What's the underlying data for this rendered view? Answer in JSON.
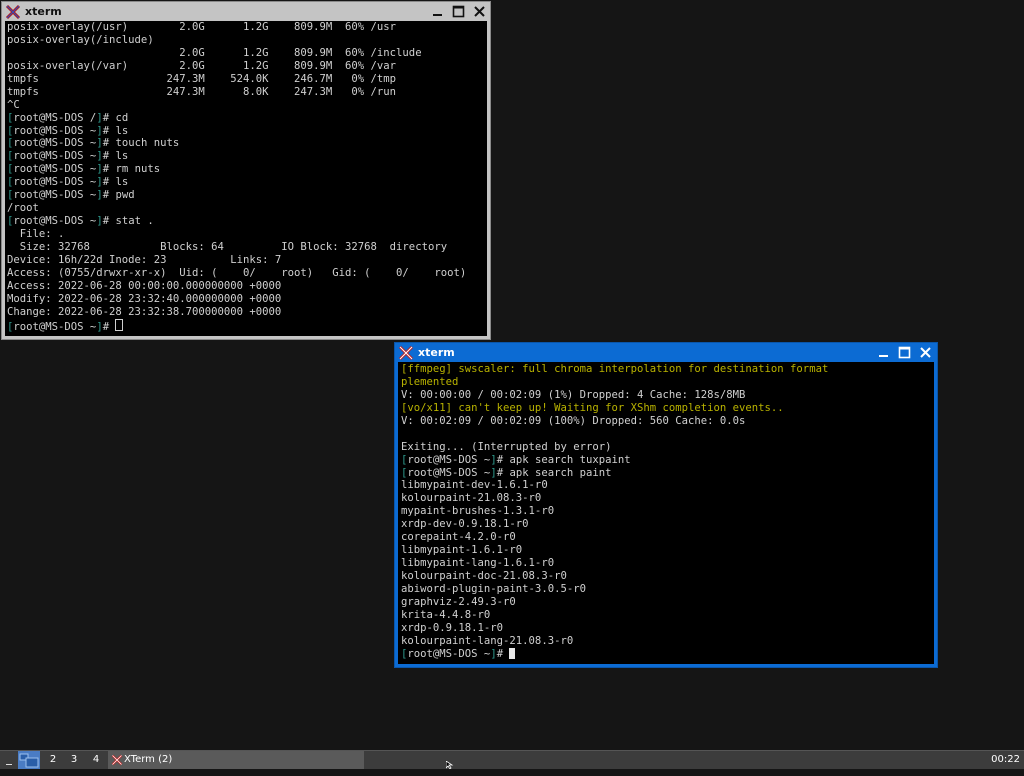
{
  "windows": {
    "left": {
      "title": "xterm",
      "lines": [
        [
          {
            "t": "posix-overlay(/usr)        2.0G      1.2G    809.9M  60% /usr"
          }
        ],
        [
          {
            "t": "posix-overlay(/include)"
          }
        ],
        [
          {
            "t": "                           2.0G      1.2G    809.9M  60% /include"
          }
        ],
        [
          {
            "t": "posix-overlay(/var)        2.0G      1.2G    809.9M  60% /var"
          }
        ],
        [
          {
            "t": "tmpfs                    247.3M    524.0K    246.7M   0% /tmp"
          }
        ],
        [
          {
            "t": "tmpfs                    247.3M      8.0K    247.3M   0% /run"
          }
        ],
        [
          {
            "t": "^C"
          }
        ],
        [
          {
            "c": "bracket",
            "t": "["
          },
          {
            "t": "root@MS-DOS /"
          },
          {
            "c": "bracket",
            "t": "]"
          },
          {
            "t": "# cd"
          }
        ],
        [
          {
            "c": "bracket",
            "t": "["
          },
          {
            "t": "root@MS-DOS ~"
          },
          {
            "c": "bracket",
            "t": "]"
          },
          {
            "t": "# ls"
          }
        ],
        [
          {
            "c": "bracket",
            "t": "["
          },
          {
            "t": "root@MS-DOS ~"
          },
          {
            "c": "bracket",
            "t": "]"
          },
          {
            "t": "# touch nuts"
          }
        ],
        [
          {
            "c": "bracket",
            "t": "["
          },
          {
            "t": "root@MS-DOS ~"
          },
          {
            "c": "bracket",
            "t": "]"
          },
          {
            "t": "# ls"
          }
        ],
        [
          {
            "c": "bracket",
            "t": "["
          },
          {
            "t": "root@MS-DOS ~"
          },
          {
            "c": "bracket",
            "t": "]"
          },
          {
            "t": "# rm nuts"
          }
        ],
        [
          {
            "c": "bracket",
            "t": "["
          },
          {
            "t": "root@MS-DOS ~"
          },
          {
            "c": "bracket",
            "t": "]"
          },
          {
            "t": "# ls"
          }
        ],
        [
          {
            "c": "bracket",
            "t": "["
          },
          {
            "t": "root@MS-DOS ~"
          },
          {
            "c": "bracket",
            "t": "]"
          },
          {
            "t": "# pwd"
          }
        ],
        [
          {
            "t": "/root"
          }
        ],
        [
          {
            "c": "bracket",
            "t": "["
          },
          {
            "t": "root@MS-DOS ~"
          },
          {
            "c": "bracket",
            "t": "]"
          },
          {
            "t": "# stat ."
          }
        ],
        [
          {
            "t": "  File: ."
          }
        ],
        [
          {
            "t": "  Size: 32768           Blocks: 64         IO Block: 32768  directory"
          }
        ],
        [
          {
            "t": "Device: 16h/22d Inode: 23          Links: 7"
          }
        ],
        [
          {
            "t": "Access: (0755/drwxr-xr-x)  Uid: (    0/    root)   Gid: (    0/    root)"
          }
        ],
        [
          {
            "t": "Access: 2022-06-28 00:00:00.000000000 +0000"
          }
        ],
        [
          {
            "t": "Modify: 2022-06-28 23:32:40.000000000 +0000"
          }
        ],
        [
          {
            "t": "Change: 2022-06-28 23:32:38.700000000 +0000"
          }
        ],
        [
          {
            "c": "bracket",
            "t": "["
          },
          {
            "t": "root@MS-DOS ~"
          },
          {
            "c": "bracket",
            "t": "]"
          },
          {
            "t": "# "
          },
          {
            "cursor": "hollow"
          }
        ]
      ]
    },
    "right": {
      "title": "xterm",
      "lines": [
        [
          {
            "c": "yellow",
            "t": "[ffmpeg] swscaler: full chroma interpolation for destination format"
          }
        ],
        [
          {
            "c": "yellow",
            "t": "plemented"
          }
        ],
        [
          {
            "t": "V: 00:00:00 / 00:02:09 (1%) Dropped: 4 Cache: 128s/8MB"
          }
        ],
        [
          {
            "c": "yellow",
            "t": "[vo/x11] can't keep up! Waiting for XShm completion events.."
          }
        ],
        [
          {
            "t": "V: 00:02:09 / 00:02:09 (100%) Dropped: 560 Cache: 0.0s"
          }
        ],
        [
          {
            "t": ""
          }
        ],
        [
          {
            "t": "Exiting... (Interrupted by error)"
          }
        ],
        [
          {
            "c": "bracket",
            "t": "["
          },
          {
            "t": "root@MS-DOS ~"
          },
          {
            "c": "bracket",
            "t": "]"
          },
          {
            "t": "# apk search tuxpaint"
          }
        ],
        [
          {
            "c": "bracket",
            "t": "["
          },
          {
            "t": "root@MS-DOS ~"
          },
          {
            "c": "bracket",
            "t": "]"
          },
          {
            "t": "# apk search paint"
          }
        ],
        [
          {
            "t": "libmypaint-dev-1.6.1-r0"
          }
        ],
        [
          {
            "t": "kolourpaint-21.08.3-r0"
          }
        ],
        [
          {
            "t": "mypaint-brushes-1.3.1-r0"
          }
        ],
        [
          {
            "t": "xrdp-dev-0.9.18.1-r0"
          }
        ],
        [
          {
            "t": "corepaint-4.2.0-r0"
          }
        ],
        [
          {
            "t": "libmypaint-1.6.1-r0"
          }
        ],
        [
          {
            "t": "libmypaint-lang-1.6.1-r0"
          }
        ],
        [
          {
            "t": "kolourpaint-doc-21.08.3-r0"
          }
        ],
        [
          {
            "t": "abiword-plugin-paint-3.0.5-r0"
          }
        ],
        [
          {
            "t": "graphviz-2.49.3-r0"
          }
        ],
        [
          {
            "t": "krita-4.4.8-r0"
          }
        ],
        [
          {
            "t": "xrdp-0.9.18.1-r0"
          }
        ],
        [
          {
            "t": "kolourpaint-lang-21.08.3-r0"
          }
        ],
        [
          {
            "c": "bracket",
            "t": "["
          },
          {
            "t": "root@MS-DOS ~"
          },
          {
            "c": "bracket",
            "t": "]"
          },
          {
            "t": "# "
          },
          {
            "cursor": "solid"
          }
        ]
      ]
    }
  },
  "taskbar": {
    "desktops": [
      "2",
      "3",
      "4"
    ],
    "task_label": "XTerm (2)",
    "clock": "00:22"
  },
  "colors": {
    "prompt_bracket": "#2e9b8e",
    "warning": "#b8b200",
    "active_titlebar": "#0c6bd3",
    "inactive_titlebar": "#c4c4c4"
  }
}
